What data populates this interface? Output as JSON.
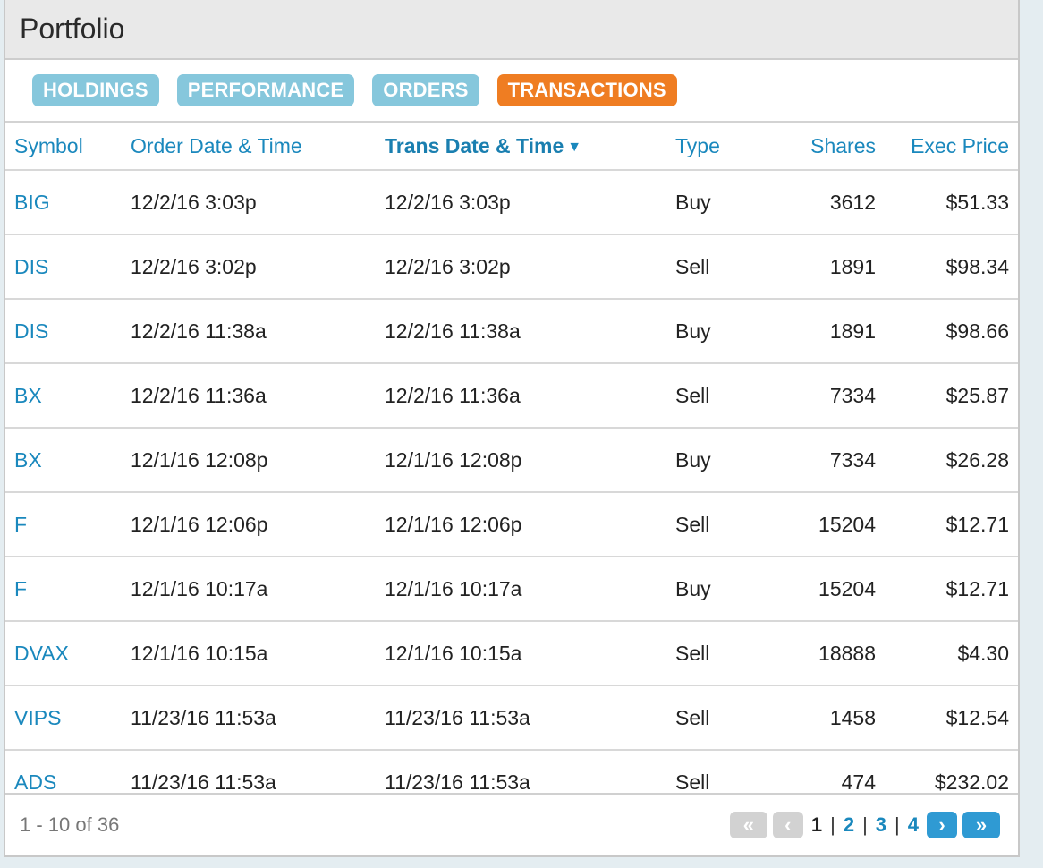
{
  "header": {
    "title": "Portfolio"
  },
  "tabs": [
    {
      "label": "HOLDINGS",
      "active": false
    },
    {
      "label": "PERFORMANCE",
      "active": false
    },
    {
      "label": "ORDERS",
      "active": false
    },
    {
      "label": "TRANSACTIONS",
      "active": true
    }
  ],
  "table": {
    "columns": [
      "Symbol",
      "Order Date & Time",
      "Trans Date & Time",
      "Type",
      "Shares",
      "Exec Price"
    ],
    "sorted_column_index": 2,
    "sort_direction": "descending",
    "rows": [
      [
        "BIG",
        "12/2/16 3:03p",
        "12/2/16 3:03p",
        "Buy",
        "3612",
        "$51.33"
      ],
      [
        "DIS",
        "12/2/16 3:02p",
        "12/2/16 3:02p",
        "Sell",
        "1891",
        "$98.34"
      ],
      [
        "DIS",
        "12/2/16 11:38a",
        "12/2/16 11:38a",
        "Buy",
        "1891",
        "$98.66"
      ],
      [
        "BX",
        "12/2/16 11:36a",
        "12/2/16 11:36a",
        "Sell",
        "7334",
        "$25.87"
      ],
      [
        "BX",
        "12/1/16 12:08p",
        "12/1/16 12:08p",
        "Buy",
        "7334",
        "$26.28"
      ],
      [
        "F",
        "12/1/16 12:06p",
        "12/1/16 12:06p",
        "Sell",
        "15204",
        "$12.71"
      ],
      [
        "F",
        "12/1/16 10:17a",
        "12/1/16 10:17a",
        "Buy",
        "15204",
        "$12.71"
      ],
      [
        "DVAX",
        "12/1/16 10:15a",
        "12/1/16 10:15a",
        "Sell",
        "18888",
        "$4.30"
      ],
      [
        "VIPS",
        "11/23/16 11:53a",
        "11/23/16 11:53a",
        "Sell",
        "1458",
        "$12.54"
      ],
      [
        "ADS",
        "11/23/16 11:53a",
        "11/23/16 11:53a",
        "Sell",
        "474",
        "$232.02"
      ]
    ]
  },
  "footer": {
    "range_text": "1 - 10 of 36",
    "pages": [
      "1",
      "2",
      "3",
      "4"
    ],
    "current_page": "1",
    "first_icon": "«",
    "prev_icon": "‹",
    "next_icon": "›",
    "last_icon": "»"
  },
  "colors": {
    "accent_blue": "#1a88bd",
    "tab_inactive": "#86c7dc",
    "tab_active": "#ef7d22",
    "pager_enabled": "#2f9ad3",
    "pager_disabled": "#d2d2d2"
  }
}
